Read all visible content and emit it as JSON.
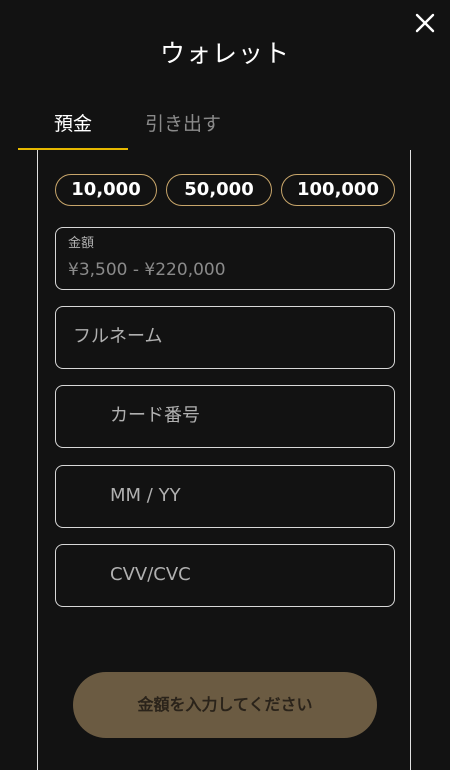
{
  "header": {
    "title": "ウォレット",
    "close_icon": "close-icon"
  },
  "tabs": [
    {
      "label": "預金",
      "active": true
    },
    {
      "label": "引き出す",
      "active": false
    }
  ],
  "colors": {
    "accent": "#e6b800",
    "chip_border": "#c7a56a",
    "button_bg": "#6b5b42",
    "background": "#121212"
  },
  "amount_presets": [
    "10,000",
    "50,000",
    "100,000"
  ],
  "form": {
    "amount": {
      "label": "金額",
      "hint": "¥3,500 - ¥220,000"
    },
    "full_name": {
      "placeholder": "フルネーム"
    },
    "card_number": {
      "placeholder": "カード番号"
    },
    "expiry": {
      "placeholder": "MM / YY"
    },
    "cvv": {
      "placeholder": "CVV/CVC"
    }
  },
  "submit": {
    "label": "金額を入力してください"
  }
}
